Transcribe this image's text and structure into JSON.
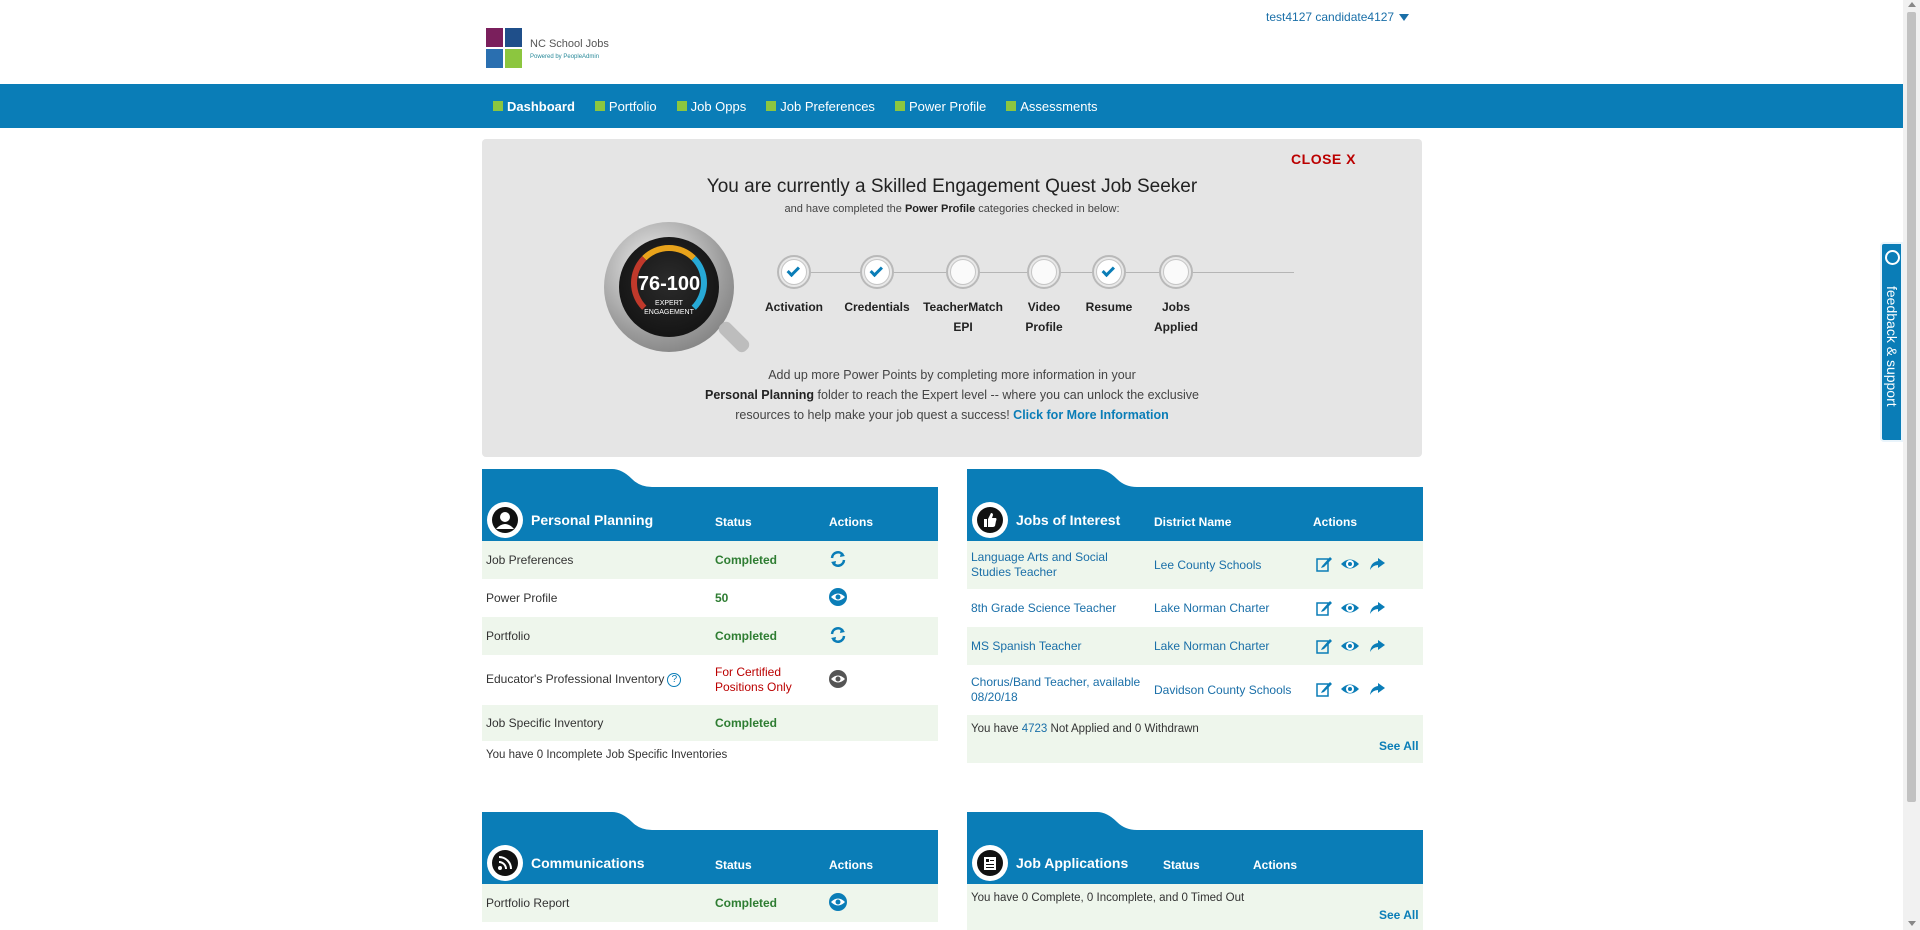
{
  "header": {
    "logo_title": "NC School Jobs",
    "logo_powered": "Powered by PeopleAdmin",
    "user_name": "test4127 candidate4127"
  },
  "nav": {
    "items": [
      "Dashboard",
      "Portfolio",
      "Job Opps",
      "Job Preferences",
      "Power Profile",
      "Assessments"
    ]
  },
  "quest": {
    "close_label": "CLOSE X",
    "title": "You are currently a Skilled Engagement Quest Job Seeker",
    "sub_pre": "and have completed the ",
    "sub_bold": "Power Profile",
    "sub_post": " categories checked in below:",
    "badge_score": "76-100",
    "badge_line1": "EXPERT",
    "badge_line2": "ENGAGEMENT",
    "steps": [
      {
        "label1": "Activation",
        "label2": "",
        "done": true
      },
      {
        "label1": "Credentials",
        "label2": "",
        "done": true
      },
      {
        "label1": "TeacherMatch",
        "label2": "EPI",
        "done": false
      },
      {
        "label1": "Video",
        "label2": "Profile",
        "done": false
      },
      {
        "label1": "Resume",
        "label2": "",
        "done": true
      },
      {
        "label1": "Jobs",
        "label2": "Applied",
        "done": false
      }
    ],
    "foot_line1": "Add up more Power Points by completing more information in your",
    "foot_bold": "Personal Planning",
    "foot_line2": " folder to reach the Expert level -- where you can unlock the exclusive",
    "foot_line3": "resources to help make your job quest a success! ",
    "foot_link": "Click for More Information"
  },
  "personal_planning": {
    "title": "Personal Planning",
    "col_status": "Status",
    "col_actions": "Actions",
    "rows": [
      {
        "name": "Job Preferences",
        "status": "Completed",
        "action": "refresh-icon"
      },
      {
        "name": "Power Profile",
        "status": "50",
        "action": "eye-icon"
      },
      {
        "name": "Portfolio",
        "status": "Completed",
        "action": "refresh-icon"
      },
      {
        "name": "Educator's Professional Inventory",
        "status_line1": "For Certified",
        "status_line2": "Positions Only",
        "action": "eye-icon"
      },
      {
        "name": "Job Specific Inventory",
        "status": "Completed",
        "action": ""
      }
    ],
    "footer": "You have 0 Incomplete Job Specific Inventories"
  },
  "jobs_of_interest": {
    "title": "Jobs of Interest",
    "col_district": "District Name",
    "col_actions": "Actions",
    "rows": [
      {
        "job_line1": "Language Arts and Social",
        "job_line2": "Studies Teacher",
        "district": "Lee County Schools"
      },
      {
        "job_line1": "8th Grade Science Teacher",
        "job_line2": "",
        "district": "Lake Norman Charter"
      },
      {
        "job_line1": "MS Spanish Teacher",
        "job_line2": "",
        "district": "Lake Norman Charter"
      },
      {
        "job_line1": "Chorus/Band Teacher, available",
        "job_line2": "08/20/18",
        "district": "Davidson County Schools"
      }
    ],
    "footer_pre": "You have ",
    "footer_count": "4723",
    "footer_post": " Not Applied and 0 Withdrawn",
    "see_all": "See All"
  },
  "communications": {
    "title": "Communications",
    "col_status": "Status",
    "col_actions": "Actions",
    "rows": [
      {
        "name": "Portfolio Report",
        "status": "Completed",
        "action": "eye-icon"
      }
    ]
  },
  "job_applications": {
    "title": "Job Applications",
    "col_status": "Status",
    "col_actions": "Actions",
    "footer": "You have 0 Complete, 0 Incomplete, and 0 Timed Out",
    "see_all": "See All"
  },
  "feedback": {
    "label": "feedback & support"
  },
  "colors": {
    "brand_blue": "#0a7db7",
    "accent_green": "#8cc63f",
    "status_green": "#2e7d32",
    "alert_red": "#bb0000"
  }
}
